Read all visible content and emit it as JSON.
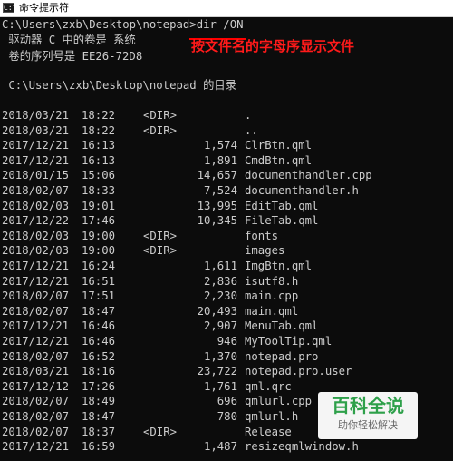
{
  "window": {
    "title": "命令提示符",
    "icon": "cmd-icon",
    "icon_glyph": "C:\\"
  },
  "console": {
    "prompt_line": "C:\\Users\\zxb\\Desktop\\notepad>dir /ON",
    "volume_line": " 驱动器 C 中的卷是 系统",
    "serial_line": " 卷的序列号是 EE26-72D8",
    "dir_header": " C:\\Users\\zxb\\Desktop\\notepad 的目录"
  },
  "annotation": {
    "text": "按文件名的字母序显示文件",
    "color": "#ff1a1a"
  },
  "listing": [
    {
      "date": "2018/03/21",
      "time": "18:22",
      "dir": "<DIR>",
      "size": "",
      "name": "."
    },
    {
      "date": "2018/03/21",
      "time": "18:22",
      "dir": "<DIR>",
      "size": "",
      "name": ".."
    },
    {
      "date": "2017/12/21",
      "time": "16:13",
      "dir": "",
      "size": "1,574",
      "name": "ClrBtn.qml"
    },
    {
      "date": "2017/12/21",
      "time": "16:13",
      "dir": "",
      "size": "1,891",
      "name": "CmdBtn.qml"
    },
    {
      "date": "2018/01/15",
      "time": "15:06",
      "dir": "",
      "size": "14,657",
      "name": "documenthandler.cpp"
    },
    {
      "date": "2018/02/07",
      "time": "18:33",
      "dir": "",
      "size": "7,524",
      "name": "documenthandler.h"
    },
    {
      "date": "2018/02/03",
      "time": "19:01",
      "dir": "",
      "size": "13,995",
      "name": "EditTab.qml"
    },
    {
      "date": "2017/12/22",
      "time": "17:46",
      "dir": "",
      "size": "10,345",
      "name": "FileTab.qml"
    },
    {
      "date": "2018/02/03",
      "time": "19:00",
      "dir": "<DIR>",
      "size": "",
      "name": "fonts"
    },
    {
      "date": "2018/02/03",
      "time": "19:00",
      "dir": "<DIR>",
      "size": "",
      "name": "images"
    },
    {
      "date": "2017/12/21",
      "time": "16:24",
      "dir": "",
      "size": "1,611",
      "name": "ImgBtn.qml"
    },
    {
      "date": "2017/12/21",
      "time": "16:51",
      "dir": "",
      "size": "2,836",
      "name": "isutf8.h"
    },
    {
      "date": "2018/02/07",
      "time": "17:51",
      "dir": "",
      "size": "2,230",
      "name": "main.cpp"
    },
    {
      "date": "2018/02/07",
      "time": "18:47",
      "dir": "",
      "size": "20,493",
      "name": "main.qml"
    },
    {
      "date": "2017/12/21",
      "time": "16:46",
      "dir": "",
      "size": "2,907",
      "name": "MenuTab.qml"
    },
    {
      "date": "2017/12/21",
      "time": "16:46",
      "dir": "",
      "size": "946",
      "name": "MyToolTip.qml"
    },
    {
      "date": "2018/02/07",
      "time": "16:52",
      "dir": "",
      "size": "1,370",
      "name": "notepad.pro"
    },
    {
      "date": "2018/03/21",
      "time": "18:16",
      "dir": "",
      "size": "23,722",
      "name": "notepad.pro.user"
    },
    {
      "date": "2017/12/12",
      "time": "17:26",
      "dir": "",
      "size": "1,761",
      "name": "qml.qrc"
    },
    {
      "date": "2018/02/07",
      "time": "18:49",
      "dir": "",
      "size": "696",
      "name": "qmlurl.cpp"
    },
    {
      "date": "2018/02/07",
      "time": "18:47",
      "dir": "",
      "size": "780",
      "name": "qmlurl.h"
    },
    {
      "date": "2018/02/07",
      "time": "18:37",
      "dir": "<DIR>",
      "size": "",
      "name": "Release"
    },
    {
      "date": "2017/12/21",
      "time": "16:59",
      "dir": "",
      "size": "1,487",
      "name": "resizeqmlwindow.h"
    }
  ],
  "watermark": {
    "title": "百科全说",
    "subtitle": "助你轻松解决"
  }
}
